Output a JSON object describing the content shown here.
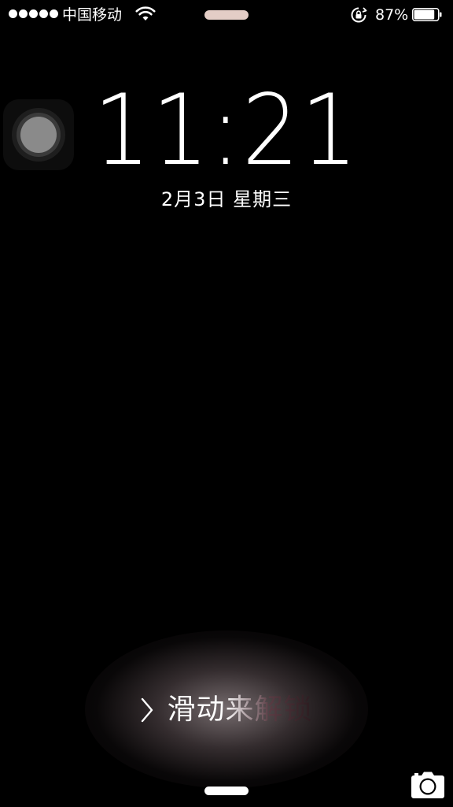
{
  "status_bar": {
    "signal_bars": 5,
    "carrier": "中国移动",
    "wifi_icon": "wifi-icon",
    "rotation_lock_icon": "rotation-lock-icon",
    "battery_percent": "87%",
    "battery_level": 0.87
  },
  "lock_screen": {
    "time": "11:21",
    "date": "2月3日 星期三",
    "unlock_text": "滑动来解锁",
    "unlock_chevron_icon": "chevron-right-icon",
    "camera_icon": "camera-icon",
    "assistive_touch_icon": "assistive-touch-icon"
  },
  "colors": {
    "background": "#000000",
    "text": "#ffffff",
    "top_pill": "#e3cdc6",
    "unlock_glow": "#d6c4c8"
  }
}
